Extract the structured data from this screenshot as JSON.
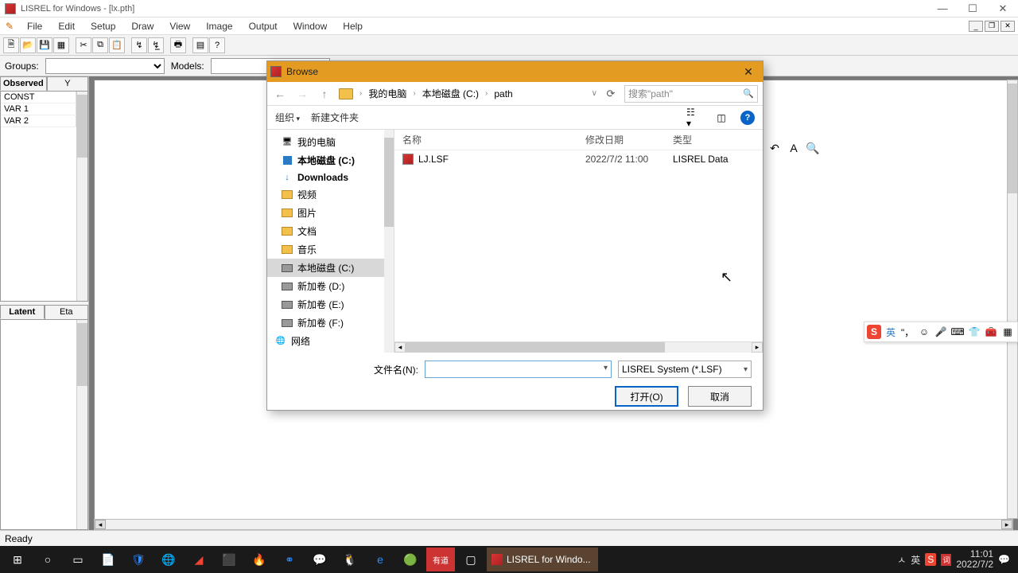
{
  "titlebar": {
    "title": "LISREL for Windows - [lx.pth]"
  },
  "menu": {
    "file": "File",
    "edit": "Edit",
    "setup": "Setup",
    "draw": "Draw",
    "view": "View",
    "image": "Image",
    "output": "Output",
    "window": "Window",
    "help": "Help"
  },
  "gm": {
    "groups": "Groups:",
    "models": "Models:"
  },
  "panel": {
    "tab_observed": "Observed",
    "tab_y": "Y",
    "vars": [
      "CONST",
      "VAR 1",
      "VAR 2"
    ],
    "tab_latent": "Latent",
    "tab_eta": "Eta"
  },
  "dialog": {
    "title": "Browse",
    "crumbs": [
      "我的电脑",
      "本地磁盘 (C:)",
      "path"
    ],
    "search_placeholder": "搜索\"path\"",
    "organize": "组织",
    "newfolder": "新建文件夹",
    "tree": [
      {
        "label": "我的电脑",
        "icon": "pc"
      },
      {
        "label": "本地磁盘 (C:)",
        "icon": "shield",
        "bold": true
      },
      {
        "label": "Downloads",
        "icon": "dl",
        "bold": true
      },
      {
        "label": "视频",
        "icon": "folder"
      },
      {
        "label": "图片",
        "icon": "folder"
      },
      {
        "label": "文档",
        "icon": "folder"
      },
      {
        "label": "音乐",
        "icon": "folder"
      },
      {
        "label": "本地磁盘 (C:)",
        "icon": "disk",
        "selected": true
      },
      {
        "label": "新加卷 (D:)",
        "icon": "disk"
      },
      {
        "label": "新加卷 (E:)",
        "icon": "disk"
      },
      {
        "label": "新加卷 (F:)",
        "icon": "disk"
      },
      {
        "label": "网络",
        "icon": "net"
      }
    ],
    "cols": {
      "name": "名称",
      "date": "修改日期",
      "type": "类型"
    },
    "files": [
      {
        "name": "LJ.LSF",
        "date": "2022/7/2 11:00",
        "type": "LISREL Data"
      }
    ],
    "filename_label": "文件名(N):",
    "filter": "LISREL System (*.LSF)",
    "open": "打开(O)",
    "cancel": "取消"
  },
  "status": {
    "ready": "Ready"
  },
  "taskbar": {
    "app": "LISREL for Windo...",
    "time": "11:01",
    "date": "2022/7/2",
    "lang": "英",
    "caret": "ㅅ"
  }
}
